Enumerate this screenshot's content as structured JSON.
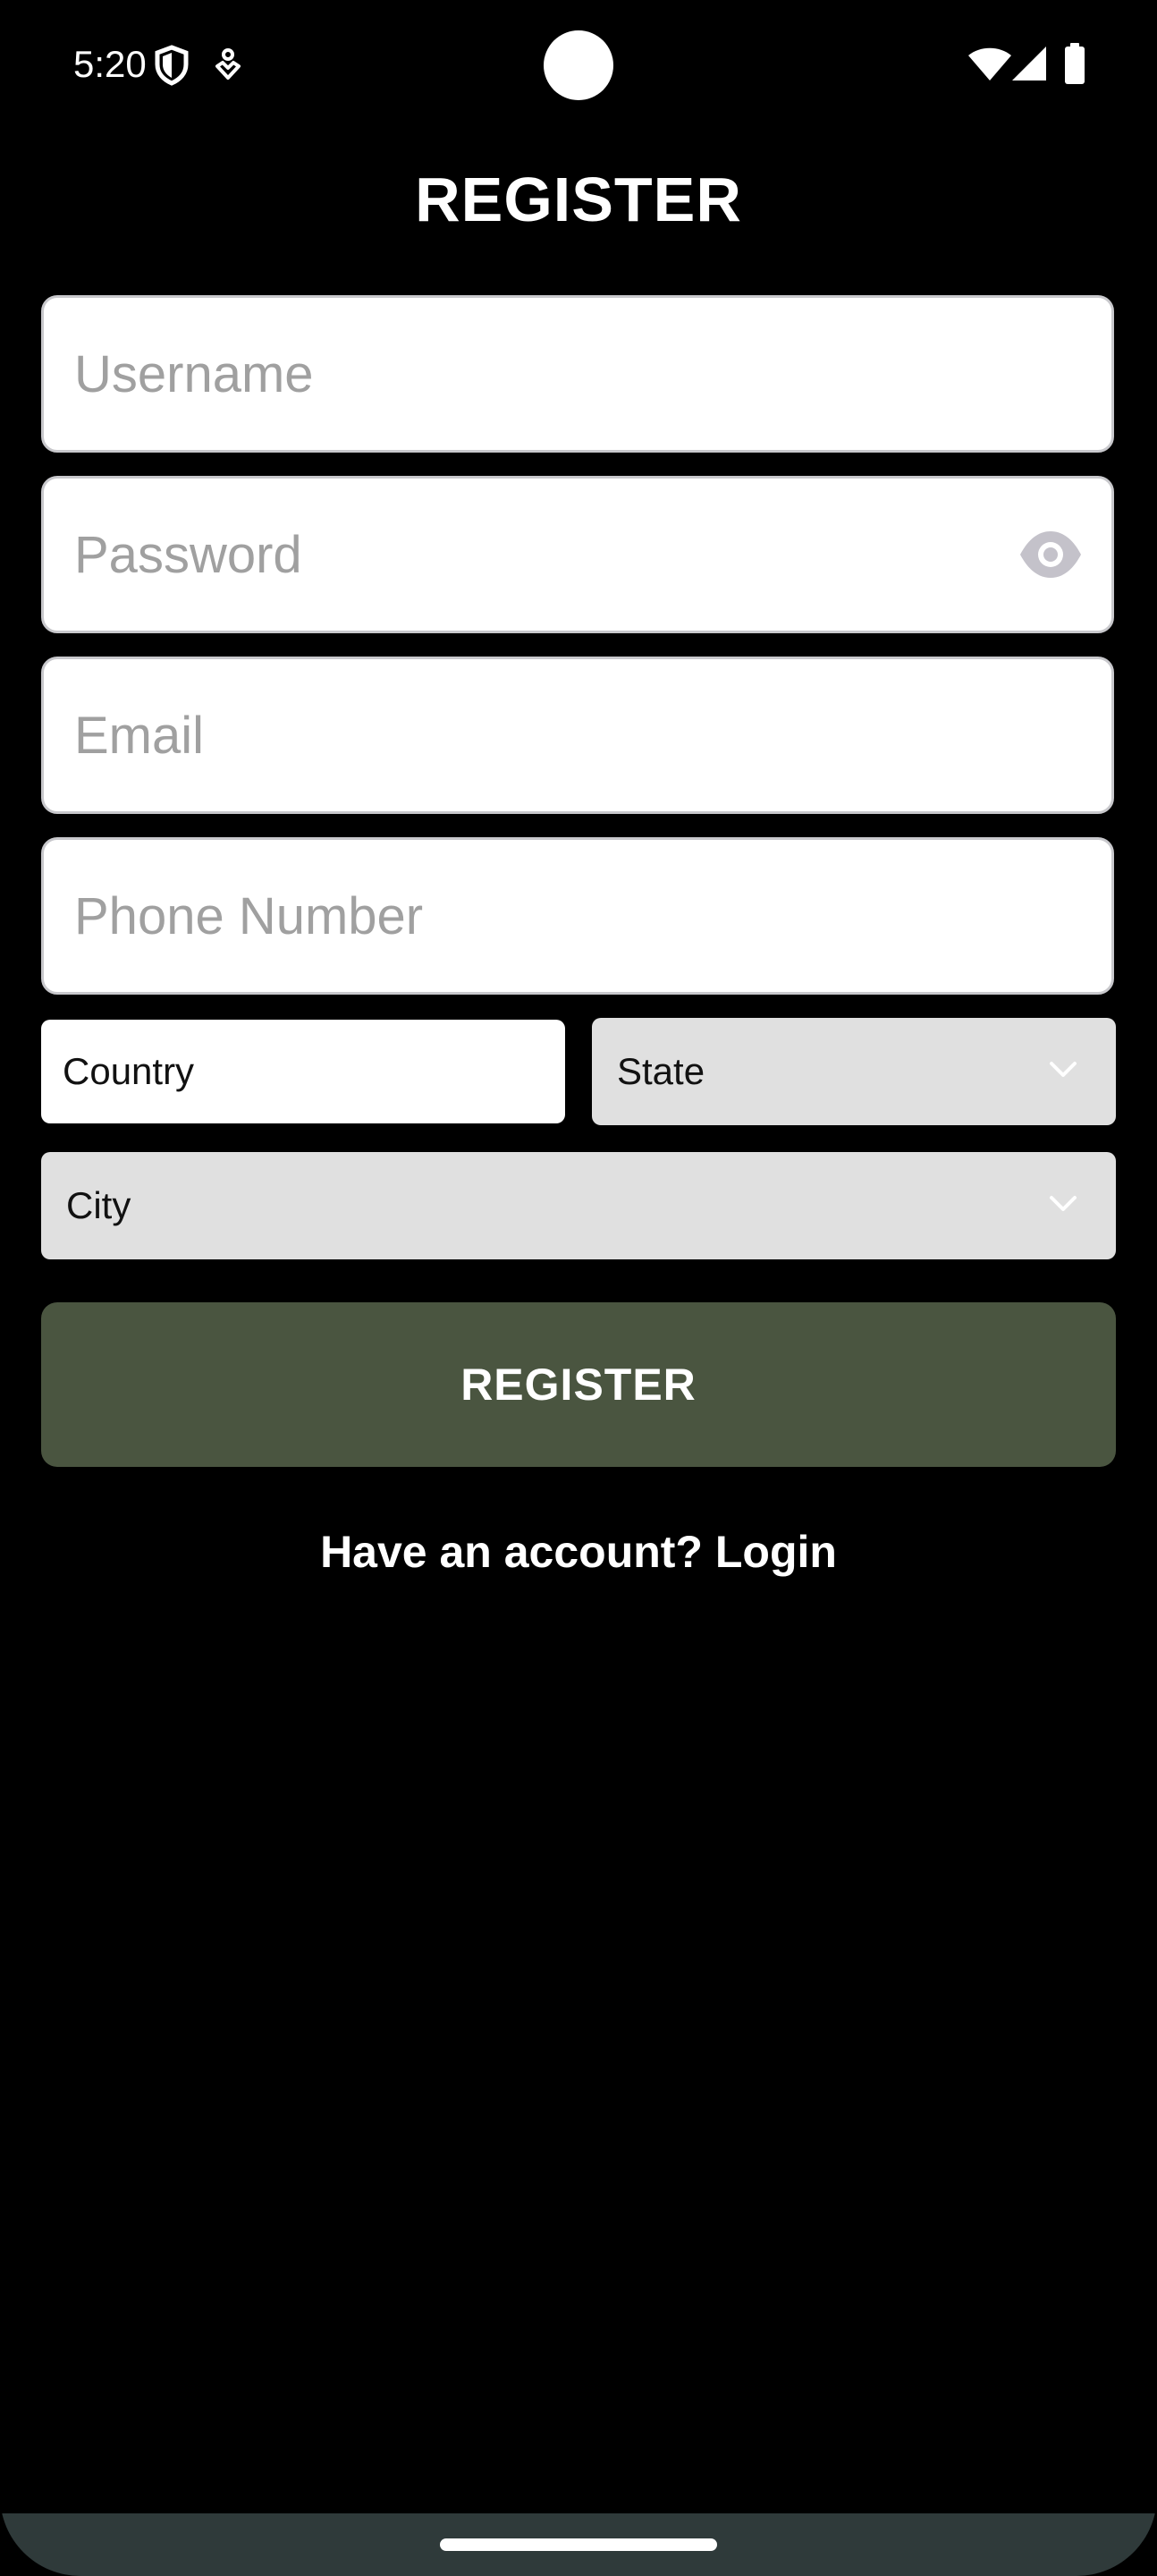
{
  "status_bar": {
    "time": "5:20",
    "icons": [
      "shield-icon",
      "assistant-icon",
      "wifi-icon",
      "signal-icon",
      "battery-icon"
    ]
  },
  "page": {
    "title": "REGISTER"
  },
  "form": {
    "username": {
      "placeholder": "Username",
      "value": ""
    },
    "password": {
      "placeholder": "Password",
      "value": "",
      "toggle_icon": "eye-icon"
    },
    "email": {
      "placeholder": "Email",
      "value": ""
    },
    "phone": {
      "placeholder": "Phone Number",
      "value": ""
    },
    "country": {
      "placeholder": "Country",
      "value": ""
    },
    "state": {
      "selected": "State"
    },
    "city": {
      "selected": "City"
    },
    "submit_label": "REGISTER"
  },
  "footer": {
    "login_prompt": "Have an account? Login"
  },
  "colors": {
    "background": "#000000",
    "button": "#4a5540",
    "dropdown": "#e0e0e0",
    "field_border": "#c8c8cc",
    "placeholder": "#a0a0a0",
    "nav_bar": "#2f3a3a"
  }
}
